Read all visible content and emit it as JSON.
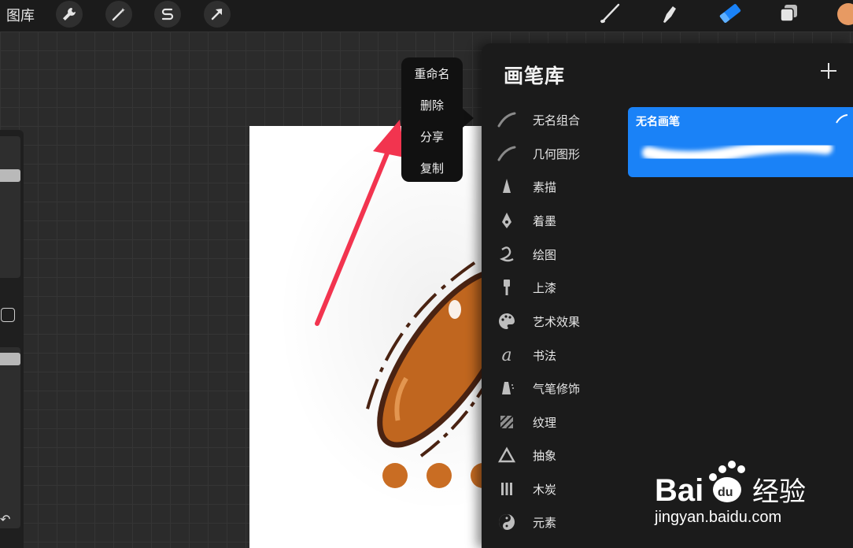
{
  "topbar": {
    "gallery_label": "图库",
    "left_tools": [
      "wrench-icon",
      "magic-wand-icon",
      "selection-s-icon",
      "transform-arrow-icon"
    ],
    "right_tools": [
      "brush-icon",
      "smudge-icon",
      "eraser-icon",
      "layers-icon"
    ],
    "active_tool": "eraser-icon",
    "accent_color": "#1a82f7",
    "current_color": "#e79a63"
  },
  "context_menu": {
    "items": [
      "重命名",
      "删除",
      "分享",
      "复制"
    ]
  },
  "brush_library": {
    "title": "画笔库",
    "categories": [
      {
        "label": "无名组合",
        "icon": "stroke-icon"
      },
      {
        "label": "几何图形",
        "icon": "stroke-icon"
      },
      {
        "label": "素描",
        "icon": "pencil-icon"
      },
      {
        "label": "着墨",
        "icon": "ink-pen-icon"
      },
      {
        "label": "绘图",
        "icon": "squiggle-icon"
      },
      {
        "label": "上漆",
        "icon": "paint-brush-icon"
      },
      {
        "label": "艺术效果",
        "icon": "palette-icon"
      },
      {
        "label": "书法",
        "icon": "calligraphy-icon"
      },
      {
        "label": "气笔修饰",
        "icon": "airbrush-icon"
      },
      {
        "label": "纹理",
        "icon": "texture-icon"
      },
      {
        "label": "抽象",
        "icon": "triangle-icon"
      },
      {
        "label": "木炭",
        "icon": "charcoal-icon"
      },
      {
        "label": "元素",
        "icon": "yin-yang-icon"
      }
    ],
    "selected_brush": {
      "name": "无名画笔"
    }
  },
  "watermark": {
    "logo_text": "Bai du 经验",
    "url": "jingyan.baidu.com"
  }
}
